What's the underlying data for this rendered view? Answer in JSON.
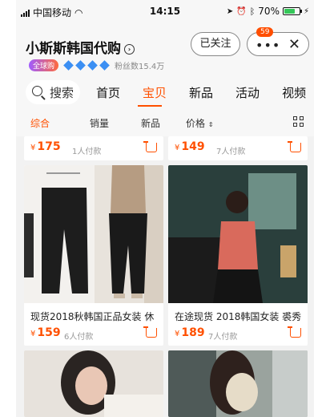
{
  "status_bar": {
    "carrier": "中国移动",
    "time": "14:15",
    "battery": "70%"
  },
  "header": {
    "shop_name": "小斯斯韩国代购",
    "follow_label": "已关注",
    "badge_count": "59",
    "qqg_label": "全球购",
    "fans": "粉丝数15.4万"
  },
  "nav": {
    "search_label": "搜索",
    "tabs": [
      "首页",
      "宝贝",
      "新品",
      "活动",
      "视频"
    ],
    "active_tab": 1
  },
  "sort": {
    "items": [
      "综合",
      "销量",
      "新品",
      "价格"
    ],
    "active": 0
  },
  "products": [
    {
      "price": "175",
      "paid": "1人付款",
      "title": ""
    },
    {
      "price": "149",
      "paid": "7人付款",
      "title": ""
    },
    {
      "price": "159",
      "paid": "6人付款",
      "title": "现货2018秋韩国正品女装 休"
    },
    {
      "price": "189",
      "paid": "7人付款",
      "title": "在途现货 2018韩国女装 裘秀"
    },
    {
      "price": "",
      "paid": "",
      "title": ""
    },
    {
      "price": "",
      "paid": "",
      "title": ""
    }
  ],
  "colors": {
    "accent": "#ff5000",
    "badge": "#ff4e00",
    "battery": "#35c759"
  }
}
